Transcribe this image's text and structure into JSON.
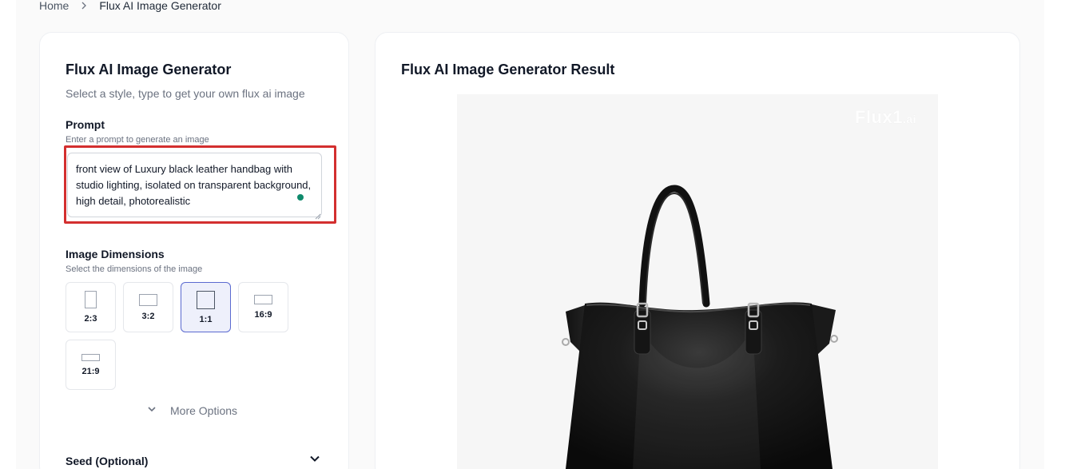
{
  "breadcrumb": {
    "home": "Home",
    "current": "Flux AI Image Generator"
  },
  "left_panel": {
    "title": "Flux AI Image Generator",
    "subtitle": "Select a style, type to get your own flux ai image",
    "prompt": {
      "label": "Prompt",
      "hint": "Enter a prompt to generate an image",
      "value": "front view of Luxury black leather handbag with studio lighting, isolated on transparent background, high detail, photorealistic"
    },
    "dimensions": {
      "label": "Image Dimensions",
      "hint": "Select the dimensions of the image",
      "options": [
        {
          "label": "2:3",
          "selected": false
        },
        {
          "label": "3:2",
          "selected": false
        },
        {
          "label": "1:1",
          "selected": true
        },
        {
          "label": "16:9",
          "selected": false
        },
        {
          "label": "21:9",
          "selected": false
        }
      ],
      "selected": "1:1"
    },
    "more_options_label": "More Options",
    "seed_label": "Seed (Optional)"
  },
  "right_panel": {
    "title": "Flux AI Image Generator Result",
    "watermark_main": "Flux1",
    "watermark_suffix": ".ai"
  },
  "colors": {
    "highlight": "#d32f2f",
    "selected_border": "#5b6ad0",
    "selected_bg": "#eef0fb",
    "status_dot": "#0f8a6c"
  }
}
